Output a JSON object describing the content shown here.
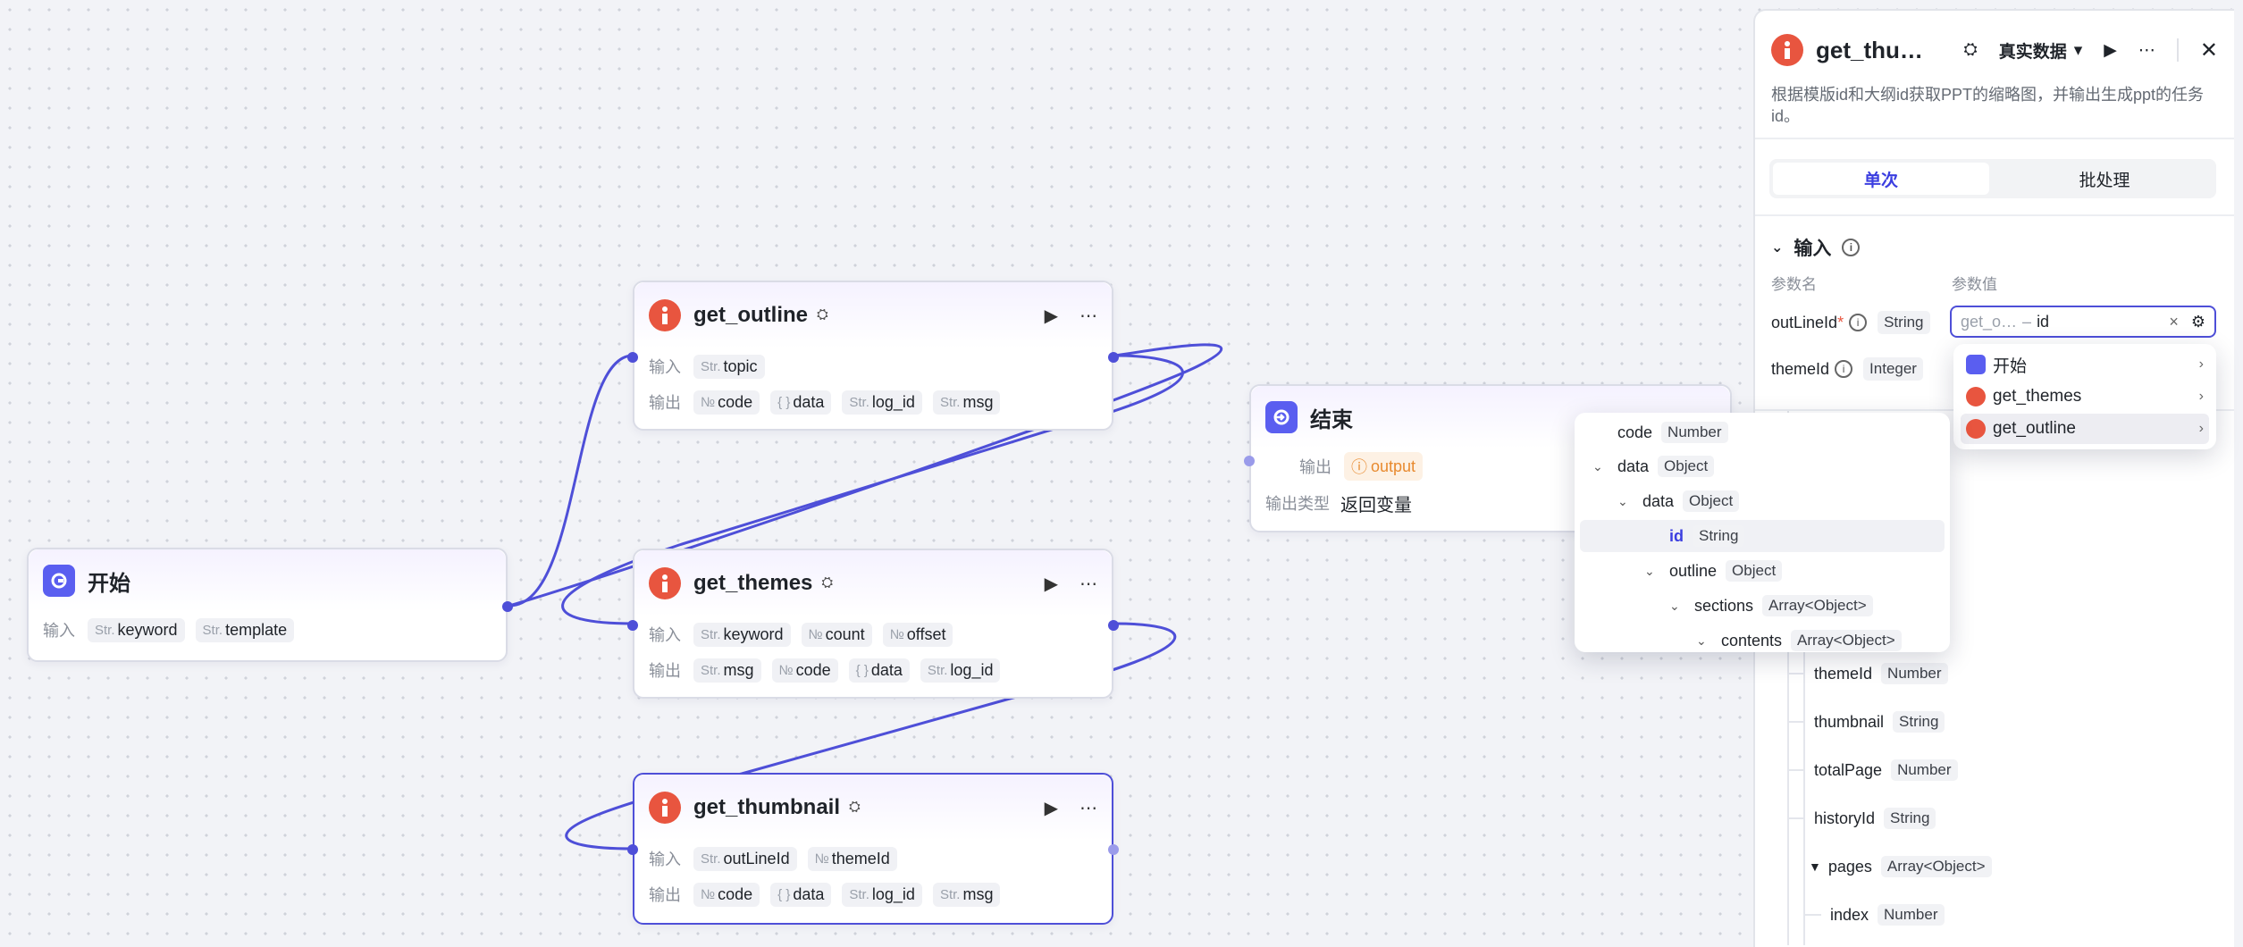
{
  "nodes": {
    "start": {
      "title": "开始",
      "input_label": "输入",
      "inputs": [
        {
          "type": "Str.",
          "name": "keyword"
        },
        {
          "type": "Str.",
          "name": "template"
        }
      ]
    },
    "get_outline": {
      "title": "get_outline",
      "input_label": "输入",
      "output_label": "输出",
      "inputs": [
        {
          "type": "Str.",
          "name": "topic"
        }
      ],
      "outputs": [
        {
          "type": "№",
          "name": "code"
        },
        {
          "type": "{ }",
          "name": "data"
        },
        {
          "type": "Str.",
          "name": "log_id"
        },
        {
          "type": "Str.",
          "name": "msg"
        }
      ]
    },
    "get_themes": {
      "title": "get_themes",
      "input_label": "输入",
      "output_label": "输出",
      "inputs": [
        {
          "type": "Str.",
          "name": "keyword"
        },
        {
          "type": "№",
          "name": "count"
        },
        {
          "type": "№",
          "name": "offset"
        }
      ],
      "outputs": [
        {
          "type": "Str.",
          "name": "msg"
        },
        {
          "type": "№",
          "name": "code"
        },
        {
          "type": "{ }",
          "name": "data"
        },
        {
          "type": "Str.",
          "name": "log_id"
        }
      ]
    },
    "get_thumbnail": {
      "title": "get_thumbnail",
      "input_label": "输入",
      "output_label": "输出",
      "inputs": [
        {
          "type": "Str.",
          "name": "outLineId"
        },
        {
          "type": "№",
          "name": "themeId"
        }
      ],
      "outputs": [
        {
          "type": "№",
          "name": "code"
        },
        {
          "type": "{ }",
          "name": "data"
        },
        {
          "type": "Str.",
          "name": "log_id"
        },
        {
          "type": "Str.",
          "name": "msg"
        }
      ]
    },
    "end": {
      "title": "结束",
      "output_label": "输出",
      "output_value": "output",
      "output_type_label": "输出类型",
      "output_type_value": "返回变量"
    }
  },
  "tree_dropdown": [
    {
      "name": "code",
      "type": "Number",
      "chev": ""
    },
    {
      "name": "data",
      "type": "Object",
      "chev": "⌄"
    },
    {
      "name": "data",
      "type": "Object",
      "chev": "⌄"
    },
    {
      "name": "id",
      "type": "String",
      "chev": ""
    },
    {
      "name": "outline",
      "type": "Object",
      "chev": "⌄"
    },
    {
      "name": "sections",
      "type": "Array<Object>",
      "chev": "⌄"
    },
    {
      "name": "contents",
      "type": "Array<Object>",
      "chev": "⌄"
    }
  ],
  "var_popup": [
    {
      "name": "开始"
    },
    {
      "name": "get_themes"
    },
    {
      "name": "get_outline"
    }
  ],
  "panel": {
    "title": "get_thu…",
    "mode": "真实数据",
    "description": "根据模版id和大纲id获取PPT的缩略图，并输出生成ppt的任务id。",
    "tab_single": "单次",
    "tab_batch": "批处理",
    "section_input": "输入",
    "col_param_name": "参数名",
    "col_param_value": "参数值",
    "params": [
      {
        "name": "outLineId",
        "required": "*",
        "type": "String"
      },
      {
        "name": "themeId",
        "required": "",
        "type": "Integer"
      }
    ],
    "value_ref_prefix": "get_o…",
    "value_ref_sep": "–",
    "value_ref_field": "id",
    "output_list": [
      {
        "name": "themeId",
        "type": "Number"
      },
      {
        "name": "thumbnail",
        "type": "String"
      },
      {
        "name": "totalPage",
        "type": "Number"
      },
      {
        "name": "historyId",
        "type": "String"
      },
      {
        "name": "pages",
        "type": "Array<Object>"
      },
      {
        "name": "index",
        "type": "Number"
      }
    ]
  },
  "colors": {
    "accent": "#4e4fd8",
    "plugin_icon": "#e8553f",
    "start_icon": "#5a5ef0",
    "warn": "#e88a2f"
  }
}
